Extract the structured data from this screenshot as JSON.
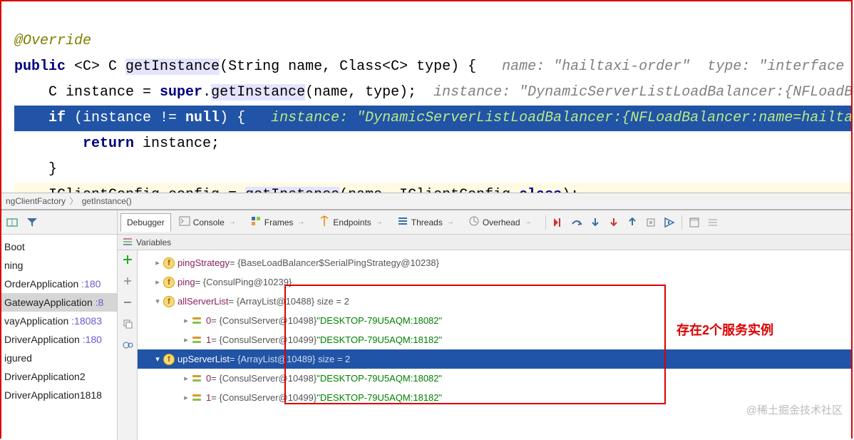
{
  "code": {
    "annotation": "@Override",
    "sig_prefix": "public ",
    "sig_generic": "<C> C ",
    "sig_method": "getInstance",
    "sig_params": "(String name, Class<C> type) {   ",
    "sig_hint": "name: \"hailtaxi-order\"  type: \"interface c",
    "line2_a": "    C instance = ",
    "line2_b": "super",
    "line2_c": ".",
    "line2_d": "getInstance",
    "line2_e": "(name, type);  ",
    "line2_hint": "instance: \"DynamicServerListLoadBalancer:{NFLoadB",
    "debug_a": "    if ",
    "debug_b": "(instance != ",
    "debug_c": "null",
    "debug_d": ") {   ",
    "debug_hint": "instance: \"DynamicServerListLoadBalancer:{NFLoadBalancer:name=hailtax",
    "return_a": "        return ",
    "return_b": "instance;",
    "brace": "    }",
    "config_a": "    IClientConfig config = ",
    "config_b": "getInstance",
    "config_c": "(name, IClientConfig.",
    "config_d": "class",
    "config_e": ");"
  },
  "breadcrumb": {
    "item1": "ngClientFactory",
    "item2": "getInstance()"
  },
  "tabs": {
    "debugger": "Debugger",
    "console": "Console",
    "frames": "Frames",
    "endpoints": "Endpoints",
    "threads": "Threads",
    "overhead": "Overhead"
  },
  "frames": [
    {
      "text": "Boot"
    },
    {
      "text": "ning"
    },
    {
      "text_a": "OrderApplication ",
      "num": ":180"
    },
    {
      "text_a": "GatewayApplication ",
      "num": ":8",
      "sel": true
    },
    {
      "text_a": "vayApplication ",
      "num": ":18083"
    },
    {
      "text_a": "DriverApplication ",
      "num": ":180"
    },
    {
      "text": "igured"
    },
    {
      "text": "DriverApplication2"
    },
    {
      "text": "DriverApplication1818"
    }
  ],
  "vars_header": "Variables",
  "tree": {
    "r0": {
      "name": "pingStrategy",
      "val": " = {BaseLoadBalancer$SerialPingStrategy@10238}"
    },
    "r1": {
      "name": "ping",
      "val": " = {ConsulPing@10239}"
    },
    "r2": {
      "name": "allServerList",
      "val": " = {ArrayList@10488}  size = 2"
    },
    "r3": {
      "name": "0",
      "val": " = {ConsulServer@10498} ",
      "str": "\"DESKTOP-79U5AQM:18082\""
    },
    "r4": {
      "name": "1",
      "val": " = {ConsulServer@10499} ",
      "str": "\"DESKTOP-79U5AQM:18182\""
    },
    "r5": {
      "name": "upServerList",
      "val": " = {ArrayList@10489}  size = 2"
    },
    "r6": {
      "name": "0",
      "val": " = {ConsulServer@10498} ",
      "str": "\"DESKTOP-79U5AQM:18082\""
    },
    "r7": {
      "name": "1",
      "val": " = {ConsulServer@10499} ",
      "str": "\"DESKTOP-79U5AQM:18182\""
    }
  },
  "annotation_text": "存在2个服务实例",
  "watermark": "@稀土掘金技术社区"
}
